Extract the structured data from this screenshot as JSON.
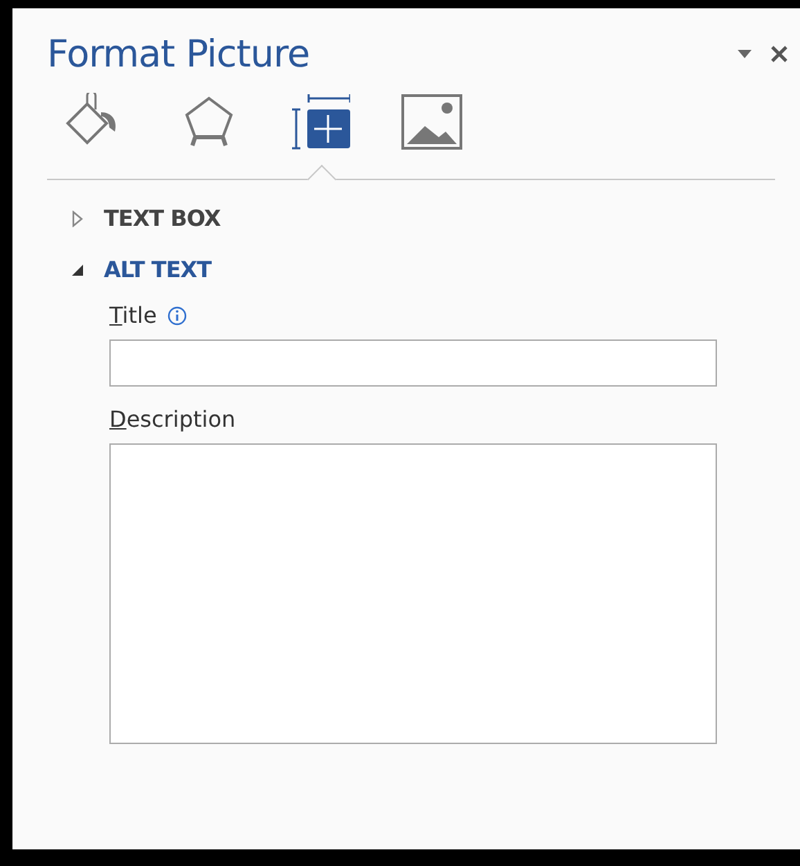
{
  "pane": {
    "title": "Format Picture"
  },
  "tabs": [
    {
      "kind": "fill",
      "selected": false
    },
    {
      "kind": "shape",
      "selected": false
    },
    {
      "kind": "layout",
      "selected": true
    },
    {
      "kind": "picture",
      "selected": false
    }
  ],
  "sections": [
    {
      "title": "TEXT BOX",
      "expanded": false
    },
    {
      "title": "ALT TEXT",
      "expanded": true,
      "fields": [
        {
          "kind": "line",
          "label": "Title",
          "info": true
        },
        {
          "kind": "area",
          "label": "Description",
          "info": false
        }
      ]
    }
  ]
}
